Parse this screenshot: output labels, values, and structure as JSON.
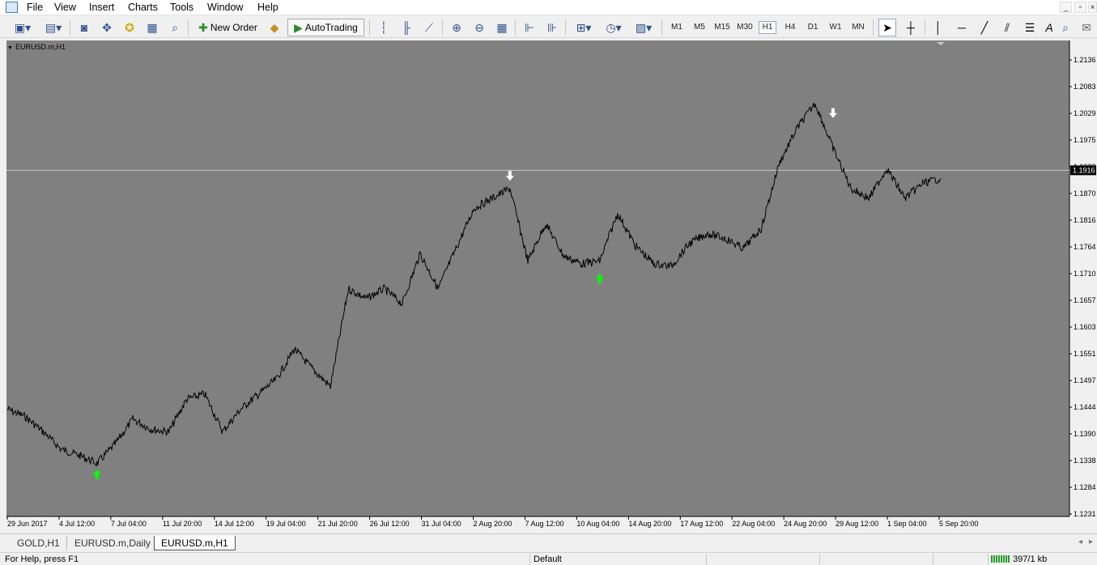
{
  "menu": [
    "File",
    "View",
    "Insert",
    "Charts",
    "Tools",
    "Window",
    "Help"
  ],
  "toolbar": {
    "new_order_label": "New Order",
    "autotrading_label": "AutoTrading",
    "timeframes": [
      "M1",
      "M5",
      "M15",
      "M30",
      "H1",
      "H4",
      "D1",
      "W1",
      "MN"
    ],
    "active_timeframe": "H1"
  },
  "chart": {
    "label": "EURUSD.m,H1",
    "background": "#808080",
    "line_color": "#000000",
    "buy_arrow_color": "#00ff00",
    "sell_arrow_color": "#ffffff",
    "current_price": "1.1916",
    "price_labels": [
      "1.2136",
      "1.2083",
      "1.2029",
      "1.1975",
      "1.1922",
      "1.1870",
      "1.1816",
      "1.1764",
      "1.1710",
      "1.1657",
      "1.1603",
      "1.1551",
      "1.1497",
      "1.1444",
      "1.1390",
      "1.1338",
      "1.1284",
      "1.1231"
    ],
    "time_labels": [
      "29 Jun 2017",
      "4 Jul 12:00",
      "7 Jul 04:00",
      "11 Jul 20:00",
      "14 Jul 12:00",
      "19 Jul 04:00",
      "21 Jul 20:00",
      "26 Jul 12:00",
      "31 Jul 04:00",
      "2 Aug 20:00",
      "7 Aug 12:00",
      "10 Aug 04:00",
      "14 Aug 20:00",
      "17 Aug 12:00",
      "22 Aug 04:00",
      "24 Aug 20:00",
      "29 Aug 12:00",
      "1 Sep 04:00",
      "5 Sep 20:00"
    ]
  },
  "chart_data": {
    "type": "line",
    "title": "EURUSD.m,H1",
    "ylim": [
      1.1231,
      1.2136
    ],
    "x_tick_labels": [
      "29 Jun 2017",
      "4 Jul 12:00",
      "7 Jul 04:00",
      "11 Jul 20:00",
      "14 Jul 12:00",
      "19 Jul 04:00",
      "21 Jul 20:00",
      "26 Jul 12:00",
      "31 Jul 04:00",
      "2 Aug 20:00",
      "7 Aug 12:00",
      "10 Aug 04:00",
      "14 Aug 20:00",
      "17 Aug 12:00",
      "22 Aug 04:00",
      "24 Aug 20:00",
      "29 Aug 12:00",
      "1 Sep 04:00",
      "5 Sep 20:00"
    ],
    "series": [
      {
        "values": [
          1.144,
          1.1425,
          1.1395,
          1.136,
          1.1348,
          1.1332,
          1.137,
          1.142,
          1.14,
          1.1395,
          1.146,
          1.147,
          1.1395,
          1.144,
          1.147,
          1.15,
          1.156,
          1.152,
          1.1485,
          1.168,
          1.166,
          1.168,
          1.165,
          1.175,
          1.168,
          1.176,
          1.184,
          1.186,
          1.188,
          1.1735,
          1.181,
          1.1745,
          1.173,
          1.1735,
          1.183,
          1.1765,
          1.173,
          1.1725,
          1.177,
          1.179,
          1.178,
          1.176,
          1.18,
          1.193,
          1.2,
          1.205,
          1.196,
          1.188,
          1.186,
          1.192,
          1.186,
          1.189,
          1.19
        ]
      }
    ],
    "markers": [
      {
        "type": "buy",
        "index": 5,
        "y": 1.131
      },
      {
        "type": "sell",
        "index": 28,
        "y": 1.1905
      },
      {
        "type": "buy",
        "index": 33,
        "y": 1.17
      },
      {
        "type": "sell",
        "index": 46,
        "y": 1.203
      }
    ],
    "horizontal_line": 1.1916
  },
  "tabs": [
    "GOLD,H1",
    "EURUSD.m,Daily",
    "EURUSD.m,H1"
  ],
  "active_tab": "EURUSD.m,H1",
  "status": {
    "help": "For Help, press F1",
    "profile": "Default",
    "traffic": "397/1 kb"
  }
}
